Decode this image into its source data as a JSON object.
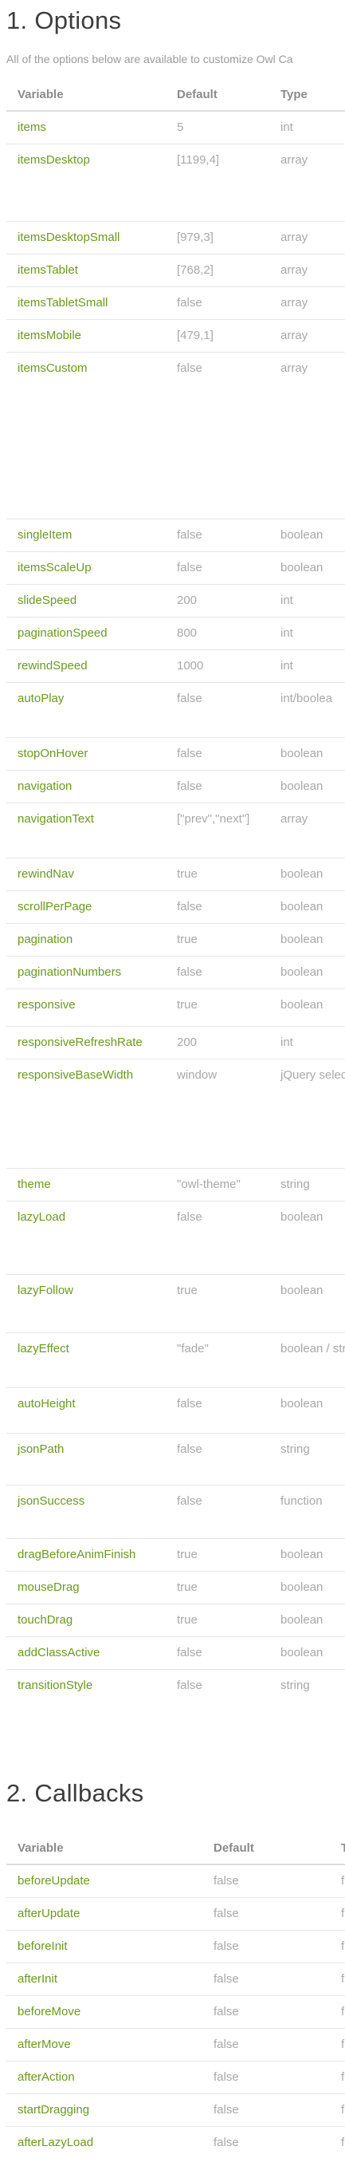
{
  "options": {
    "title": "1. Options",
    "intro": "All of the options below are available to customize Owl Ca",
    "headers": [
      "Variable",
      "Default",
      "Type"
    ],
    "rows": [
      {
        "variable": "items",
        "default": "5",
        "type": "int"
      },
      {
        "variable": "itemsDesktop",
        "default": "[1199,4]",
        "type": "array"
      },
      {
        "variable": "itemsDesktopSmall",
        "default": "[979,3]",
        "type": "array"
      },
      {
        "variable": "itemsTablet",
        "default": "[768,2]",
        "type": "array"
      },
      {
        "variable": "itemsTabletSmall",
        "default": "false",
        "type": "array"
      },
      {
        "variable": "itemsMobile",
        "default": "[479,1]",
        "type": "array"
      },
      {
        "variable": "itemsCustom",
        "default": "false",
        "type": "array"
      },
      {
        "variable": "singleItem",
        "default": "false",
        "type": "boolean"
      },
      {
        "variable": "itemsScaleUp",
        "default": "false",
        "type": "boolean"
      },
      {
        "variable": "slideSpeed",
        "default": "200",
        "type": "int"
      },
      {
        "variable": "paginationSpeed",
        "default": "800",
        "type": "int"
      },
      {
        "variable": "rewindSpeed",
        "default": "1000",
        "type": "int"
      },
      {
        "variable": "autoPlay",
        "default": "false",
        "type": "int/boolea"
      },
      {
        "variable": "stopOnHover",
        "default": "false",
        "type": "boolean"
      },
      {
        "variable": "navigation",
        "default": "false",
        "type": "boolean"
      },
      {
        "variable": "navigationText",
        "default": "[\"prev\",\"next\"]",
        "type": "array"
      },
      {
        "variable": "rewindNav",
        "default": "true",
        "type": "boolean"
      },
      {
        "variable": "scrollPerPage",
        "default": "false",
        "type": "boolean"
      },
      {
        "variable": "pagination",
        "default": "true",
        "type": "boolean"
      },
      {
        "variable": "paginationNumbers",
        "default": "false",
        "type": "boolean"
      },
      {
        "variable": "responsive",
        "default": "true",
        "type": "boolean"
      },
      {
        "variable": "responsiveRefreshRate",
        "default": "200",
        "type": "int"
      },
      {
        "variable": "responsiveBaseWidth",
        "default": "window",
        "type": "jQuery selector"
      },
      {
        "variable": "theme",
        "default": "\"owl-theme\"",
        "type": "string"
      },
      {
        "variable": "lazyLoad",
        "default": "false",
        "type": "boolean"
      },
      {
        "variable": "lazyFollow",
        "default": "true",
        "type": "boolean"
      },
      {
        "variable": "lazyEffect",
        "default": "\"fade\"",
        "type": "boolean / string"
      },
      {
        "variable": "autoHeight",
        "default": "false",
        "type": "boolean"
      },
      {
        "variable": "jsonPath",
        "default": "false",
        "type": "string"
      },
      {
        "variable": "jsonSuccess",
        "default": "false",
        "type": "function"
      },
      {
        "variable": "dragBeforeAnimFinish",
        "default": "true",
        "type": "boolean"
      },
      {
        "variable": "mouseDrag",
        "default": "true",
        "type": "boolean"
      },
      {
        "variable": "touchDrag",
        "default": "true",
        "type": "boolean"
      },
      {
        "variable": "addClassActive",
        "default": "false",
        "type": "boolean"
      },
      {
        "variable": "transitionStyle",
        "default": "false",
        "type": "string"
      }
    ]
  },
  "callbacks": {
    "title": "2. Callbacks",
    "headers": [
      "Variable",
      "Default",
      "T"
    ],
    "rows": [
      {
        "variable": "beforeUpdate",
        "default": "false",
        "type": "f"
      },
      {
        "variable": "afterUpdate",
        "default": "false",
        "type": "f"
      },
      {
        "variable": "beforeInit",
        "default": "false",
        "type": "f"
      },
      {
        "variable": "afterInit",
        "default": "false",
        "type": "f"
      },
      {
        "variable": "beforeMove",
        "default": "false",
        "type": "f"
      },
      {
        "variable": "afterMove",
        "default": "false",
        "type": "f"
      },
      {
        "variable": "afterAction",
        "default": "false",
        "type": "f"
      },
      {
        "variable": "startDragging",
        "default": "false",
        "type": "f"
      },
      {
        "variable": "afterLazyLoad",
        "default": "false",
        "type": "f"
      }
    ]
  }
}
